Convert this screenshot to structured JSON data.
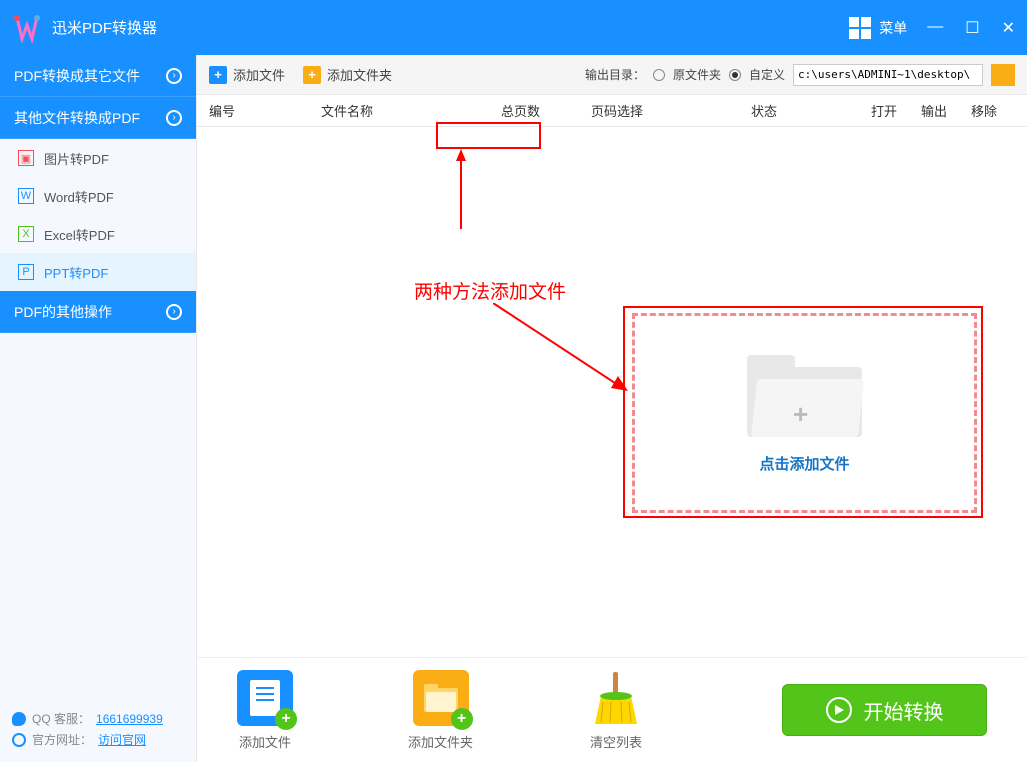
{
  "titlebar": {
    "app_title": "迅米PDF转换器",
    "menu_label": "菜单"
  },
  "sidebar": {
    "cat1": "PDF转换成其它文件",
    "cat2": "其他文件转换成PDF",
    "cat3": "PDF的其他操作",
    "items": [
      {
        "label": "图片转PDF"
      },
      {
        "label": "Word转PDF"
      },
      {
        "label": "Excel转PDF"
      },
      {
        "label": "PPT转PDF"
      }
    ],
    "footer": {
      "qq_label": "QQ 客服：",
      "qq_num": "1661699939",
      "site_label": "官方网址：",
      "site_link": "访问官网"
    }
  },
  "toolbar": {
    "add_file": "添加文件",
    "add_folder": "添加文件夹",
    "output_label": "输出目录：",
    "radio_original": "原文件夹",
    "radio_custom": "自定义",
    "path_value": "c:\\users\\ADMINI~1\\desktop\\"
  },
  "columns": {
    "c1": "编号",
    "c2": "文件名称",
    "c3": "总页数",
    "c4": "页码选择",
    "c5": "状态",
    "c6": "打开",
    "c7": "输出",
    "c8": "移除"
  },
  "dropzone": {
    "text": "点击添加文件"
  },
  "bottom": {
    "add_file": "添加文件",
    "add_folder": "添加文件夹",
    "clear": "清空列表",
    "start": "开始转换"
  },
  "annotation": {
    "text": "两种方法添加文件"
  }
}
